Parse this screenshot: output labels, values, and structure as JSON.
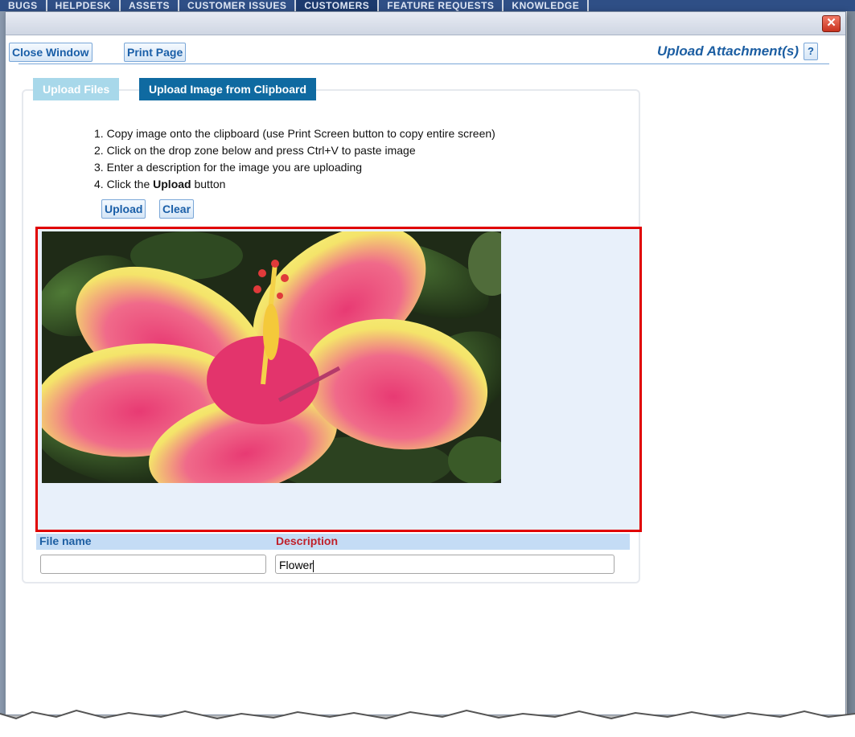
{
  "background_nav": {
    "items": [
      "BUGS",
      "HELPDESK",
      "ASSETS",
      "CUSTOMER ISSUES",
      "CUSTOMERS",
      "FEATURE REQUESTS",
      "KNOWLEDGE"
    ],
    "active_index": 4
  },
  "dialog": {
    "close_label": "✕",
    "toolbar": {
      "close_window_label": "Close Window",
      "print_page_label": "Print Page"
    },
    "title": "Upload Attachment(s)",
    "help_label": "?"
  },
  "tabs": [
    {
      "label": "Upload Files",
      "active": false
    },
    {
      "label": "Upload Image from Clipboard",
      "active": true
    }
  ],
  "instructions": {
    "step1": "1. Copy image onto the clipboard (use Print Screen button to copy entire screen)",
    "step2": "2. Click on the drop zone below and press Ctrl+V to paste image",
    "step3": "3. Enter a description for the image you are uploading",
    "step4_prefix": "4. Click the ",
    "step4_bold": "Upload",
    "step4_suffix": " button"
  },
  "actions": {
    "upload_label": "Upload",
    "clear_label": "Clear"
  },
  "dropzone": {
    "pasted_image": "hibiscus-flower-photo"
  },
  "grid": {
    "file_name_header": "File name",
    "description_header": "Description",
    "file_name_value": "",
    "description_value": "Flower"
  },
  "colors": {
    "accent_blue": "#1c5ea2",
    "active_tab": "#0f6aa1",
    "inactive_tab": "#a8d8ea",
    "dropzone_border": "#e00000",
    "description_header": "#c0202a"
  }
}
